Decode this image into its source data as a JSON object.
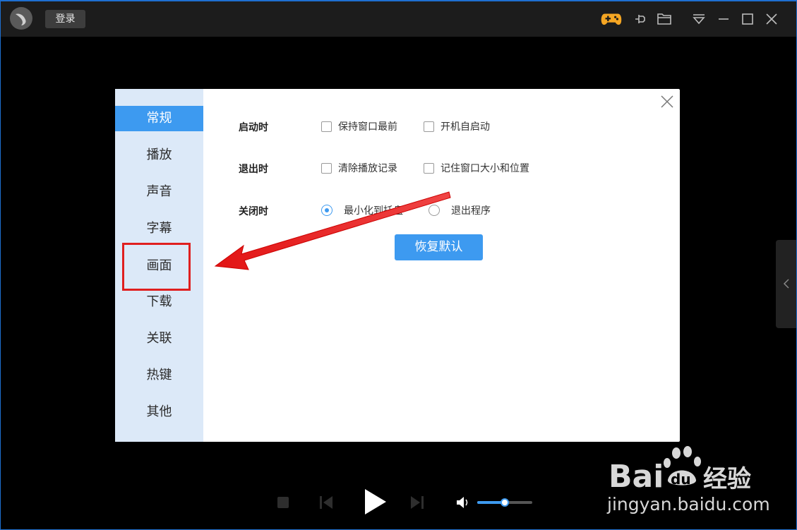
{
  "titlebar": {
    "login_label": "登录"
  },
  "dialog": {
    "nav": [
      {
        "label": "常规",
        "active": true
      },
      {
        "label": "播放"
      },
      {
        "label": "声音"
      },
      {
        "label": "字幕"
      },
      {
        "label": "画面"
      },
      {
        "label": "下载"
      },
      {
        "label": "关联"
      },
      {
        "label": "热键"
      },
      {
        "label": "其他"
      }
    ],
    "rows": {
      "startup": {
        "label": "启动时",
        "opt1": "保持窗口最前",
        "opt2": "开机自启动"
      },
      "exit": {
        "label": "退出时",
        "opt1": "清除播放记录",
        "opt2": "记住窗口大小和位置"
      },
      "close": {
        "label": "关闭时",
        "opt1": "最小化到托盘",
        "opt2": "退出程序",
        "selected": "opt1"
      }
    },
    "restore_label": "恢复默认"
  },
  "player": {
    "volume": 0.5
  },
  "watermark": {
    "brand": "Baidu经验",
    "url": "jingyan.baidu.com"
  },
  "colors": {
    "accent": "#3d9af0",
    "sidebar": "#dce9f8",
    "highlight": "#e01f1f"
  }
}
